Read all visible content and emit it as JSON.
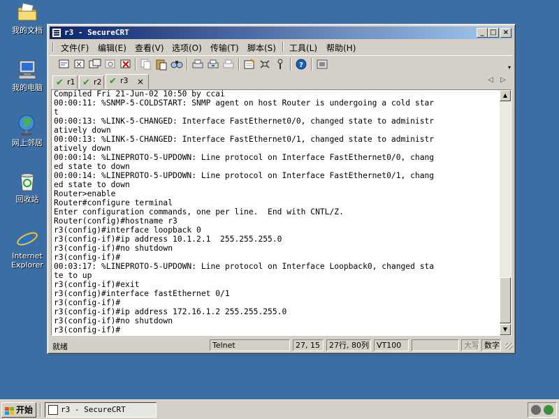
{
  "desktop": {
    "icons": [
      {
        "label": "我的文档",
        "icon": "my-documents-icon"
      },
      {
        "label": "我的电脑",
        "icon": "my-computer-icon"
      },
      {
        "label": "网上邻居",
        "icon": "network-places-icon"
      },
      {
        "label": "回收站",
        "icon": "recycle-bin-icon"
      },
      {
        "label": "Internet Explorer",
        "icon": "internet-explorer-icon"
      }
    ]
  },
  "window": {
    "title": "r3 - SecureCRT",
    "buttons": {
      "minimize": "_",
      "maximize": "□",
      "close": "×"
    }
  },
  "menu": {
    "items": [
      "文件(F)",
      "编辑(E)",
      "查看(V)",
      "选项(O)",
      "传输(T)",
      "脚本(S)",
      "工具(L)",
      "帮助(H)"
    ]
  },
  "tabs": {
    "items": [
      {
        "label": "r1",
        "active": false
      },
      {
        "label": "r2",
        "active": false
      },
      {
        "label": "r3",
        "active": true
      }
    ],
    "close_glyph": "×",
    "nav_left": "◁",
    "nav_right": "▷"
  },
  "terminal": {
    "lines": [
      "Compiled Fri 21-Jun-02 10:50 by ccai",
      "00:00:11: %SNMP-5-COLDSTART: SNMP agent on host Router is undergoing a cold star",
      "t",
      "00:00:13: %LINK-5-CHANGED: Interface FastEthernet0/0, changed state to administr",
      "atively down",
      "00:00:13: %LINK-5-CHANGED: Interface FastEthernet0/1, changed state to administr",
      "atively down",
      "00:00:14: %LINEPROTO-5-UPDOWN: Line protocol on Interface FastEthernet0/0, chang",
      "ed state to down",
      "00:00:14: %LINEPROTO-5-UPDOWN: Line protocol on Interface FastEthernet0/1, chang",
      "ed state to down",
      "Router>enable",
      "Router#configure terminal",
      "Enter configuration commands, one per line.  End with CNTL/Z.",
      "Router(config)#hostname r3",
      "r3(config)#interface loopback 0",
      "r3(config-if)#ip address 10.1.2.1  255.255.255.0",
      "r3(config-if)#no shutdown",
      "r3(config-if)#",
      "00:03:17: %LINEPROTO-5-UPDOWN: Line protocol on Interface Loopback0, changed sta",
      "te to up",
      "r3(config-if)#exit",
      "r3(config)#interface fastEthernet 0/1",
      "r3(config-if)#",
      "r3(config-if)#ip address 172.16.1.2 255.255.255.0",
      "r3(config-if)#no shutdown",
      "r3(config-if)#"
    ]
  },
  "status": {
    "ready": "就绪",
    "protocol": "Telnet",
    "cursor": "27, 15",
    "size": "27行, 80列",
    "emulation": "VT100",
    "caps": "大写",
    "num": "数字"
  },
  "taskbar": {
    "start_label": "开始",
    "task_label": "r3 - SecureCRT"
  }
}
